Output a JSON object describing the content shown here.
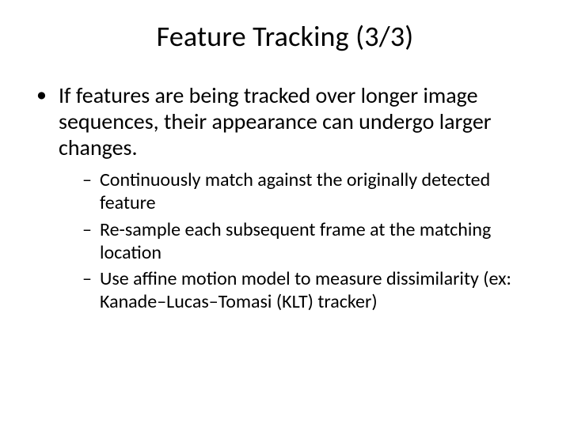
{
  "slide": {
    "title": "Feature Tracking (3/3)",
    "bullets": [
      {
        "text": "If features are being tracked over longer image sequences, their appearance can undergo larger changes.",
        "sub": [
          "Continuously match against the originally detected feature",
          "Re-sample each subsequent frame at the matching location",
          "Use affine motion model to measure dissimilarity (ex: Kanade–Lucas–Tomasi (KLT) tracker)"
        ]
      }
    ]
  }
}
